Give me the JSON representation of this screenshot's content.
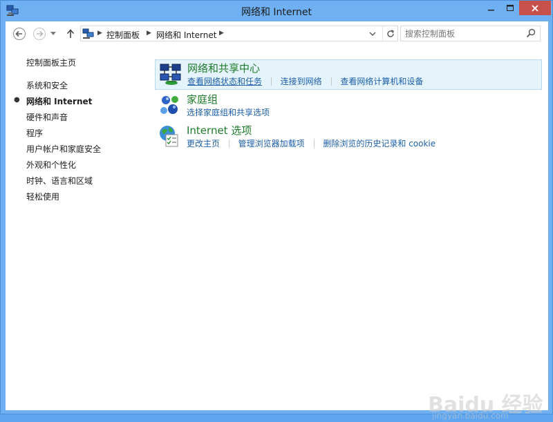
{
  "window": {
    "title": "网络和 Internet"
  },
  "addressbar": {
    "crumbs": [
      "控制面板",
      "网络和 Internet"
    ],
    "search_placeholder": "搜索控制面板"
  },
  "sidebar": {
    "home": "控制面板主页",
    "items": [
      {
        "label": "系统和安全",
        "current": false
      },
      {
        "label": "网络和 Internet",
        "current": true
      },
      {
        "label": "硬件和声音",
        "current": false
      },
      {
        "label": "程序",
        "current": false
      },
      {
        "label": "用户帐户和家庭安全",
        "current": false
      },
      {
        "label": "外观和个性化",
        "current": false
      },
      {
        "label": "时钟、语言和区域",
        "current": false
      },
      {
        "label": "轻松使用",
        "current": false
      }
    ]
  },
  "categories": [
    {
      "title": "网络和共享中心",
      "icon": "network-sharing-center-icon",
      "links": [
        "查看网络状态和任务",
        "连接到网络",
        "查看网络计算机和设备"
      ]
    },
    {
      "title": "家庭组",
      "icon": "homegroup-icon",
      "links": [
        "选择家庭组和共享选项"
      ]
    },
    {
      "title": "Internet 选项",
      "icon": "internet-options-icon",
      "links": [
        "更改主页",
        "管理浏览器加载项",
        "删除浏览的历史记录和 cookie"
      ]
    }
  ],
  "watermark": {
    "text": "Baidu 经验",
    "sub": "jingyan.baidu.com"
  },
  "colors": {
    "titlebar": "#6fb0f2",
    "close_button": "#c7504a",
    "category_title": "#1e7b2c",
    "link": "#1c5fa8",
    "selection": "#e5f3fb"
  }
}
